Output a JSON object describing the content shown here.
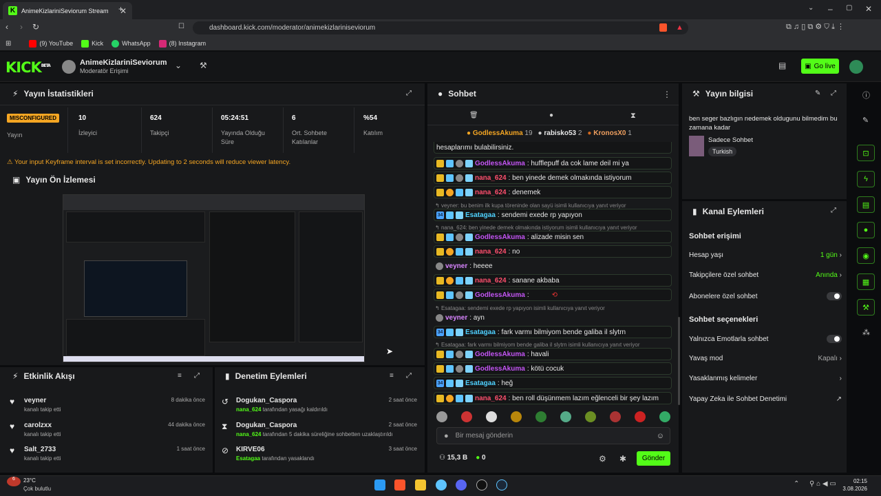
{
  "browser": {
    "tab_title": "AnimeKizlariniSeviorum Stream",
    "url": "dashboard.kick.com/moderator/animekizlariniseviorum",
    "bookmarks": [
      "(9) YouTube",
      "Kick",
      "WhatsApp",
      "(8) Instagram"
    ]
  },
  "header": {
    "logo": "KICK",
    "logo_beta": "BETA",
    "channel_name": "AnimeKizlariniSeviorum",
    "role": "Moderatör Erişimi",
    "go_live": "Go live"
  },
  "stats": {
    "title": "Yayın İstatistikleri",
    "status_badge": "MISCONFIGURED",
    "status_label": "Yayın",
    "items": [
      {
        "value": "10",
        "label": "İzleyici"
      },
      {
        "value": "624",
        "label": "Takipçi"
      },
      {
        "value": "05:24:51",
        "label": "Yayında Olduğu Süre"
      },
      {
        "value": "6",
        "label": "Ort. Sohbete Katılanlar"
      },
      {
        "value": "%54",
        "label": "Katılım"
      }
    ],
    "warning": "Your input Keyframe interval is set incorrectly. Updating to 2 seconds will reduce viewer latency."
  },
  "preview": {
    "title": "Yayın Ön İzlemesi"
  },
  "activity": {
    "title": "Etkinlik Akışı",
    "items": [
      {
        "name": "veyner",
        "sub": "kanalı takip etti",
        "time": "8 dakika önce"
      },
      {
        "name": "carolzxx",
        "sub": "kanalı takip etti",
        "time": "44 dakika önce"
      },
      {
        "name": "Salt_2733",
        "sub": "kanalı takip etti",
        "time": "1 saat önce"
      }
    ]
  },
  "moderation": {
    "title": "Denetim Eylemleri",
    "items": [
      {
        "name": "Dogukan_Caspora",
        "target": "nana_624",
        "rest": " tarafından yasağı kaldırıldı",
        "time": "2 saat önce"
      },
      {
        "name": "Dogukan_Caspora",
        "target": "nana_624",
        "rest": " tarafından 5 dakika süreliğine sohbetten uzaklaştırıldı",
        "time": "2 saat önce"
      },
      {
        "name": "KIRVE06",
        "target": "Esatagaa",
        "rest": " tarafından yasaklandı",
        "time": "3 saat önce"
      }
    ]
  },
  "chat": {
    "title": "Sohbet",
    "top": [
      {
        "name": "GodlessAkuma",
        "count": "19"
      },
      {
        "name": "rabisko53",
        "count": "2"
      },
      {
        "name": "KronosX0",
        "count": "1"
      }
    ],
    "first_line": "hesaplarımı bulabilirsiniz.",
    "messages": [
      {
        "user": "GodlessAkuma",
        "text": ": hufflepuff da cok lame deil mi ya",
        "color": "#c455f5"
      },
      {
        "user": "nana_624",
        "text": ": ben yinede demek olmakında istiyorum",
        "color": "#ff4f6d"
      },
      {
        "user": "nana_624",
        "text": ": denemek",
        "color": "#ff4f6d"
      },
      {
        "reply": "veyner: bu benim ilk kupa töreninde olan sayü isimli kullanıcıya yanıt veriyor"
      },
      {
        "user": "Esatagaa",
        "text": ": sendemi exede rp yapıyon",
        "color": "#4fd1ff"
      },
      {
        "reply": "nana_624: ben yinede demek olmakında istiyorum isimli kullanıcıya yanıt veriyor"
      },
      {
        "user": "GodlessAkuma",
        "text": ": alizade misin sen",
        "color": "#c455f5"
      },
      {
        "user": "nana_624",
        "text": ": no",
        "color": "#ff4f6d"
      },
      {
        "user": "veyner",
        "text": ": heeee",
        "color": "#d985ff"
      },
      {
        "user": "nana_624",
        "text": ": sanane akbaba",
        "color": "#ff4f6d"
      },
      {
        "user": "GodlessAkuma",
        "text": ":",
        "color": "#c455f5"
      },
      {
        "reply": "Esatagaa: sendemi exede rp yapıyon isimli kullanıcıya yanıt veriyor"
      },
      {
        "user": "veyner",
        "text": ": ayn",
        "color": "#d985ff"
      },
      {
        "user": "Esatagaa",
        "text": ": fark varmı bilmiyom bende galiba il slytrn",
        "color": "#4fd1ff"
      },
      {
        "reply": "Esatagaa: fark varmı bilmiyom bende galiba il slytrn isimli kullanıcıya yanıt veriyor"
      },
      {
        "user": "GodlessAkuma",
        "text": ": havali",
        "color": "#c455f5"
      },
      {
        "user": "GodlessAkuma",
        "text": ": kötü cocuk",
        "color": "#c455f5"
      },
      {
        "user": "Esatagaa",
        "text": ": heğ",
        "color": "#4fd1ff"
      },
      {
        "user": "nana_624",
        "text": ": ben roll düşünmem lazım eğlenceli bir şey lazım",
        "color": "#ff4f6d"
      }
    ],
    "input_placeholder": "Bir mesaj gönderin",
    "viewers": "15,3 B",
    "kicks": "0",
    "send": "Gönder"
  },
  "info": {
    "title": "Yayın bilgisi",
    "stream_title": "ben seger bazlıgın nedemek oldugunu bilmedim bu zamana kadar",
    "category": "Sadece Sohbet",
    "tag": "Turkish"
  },
  "actions": {
    "title": "Kanal Eylemleri",
    "access_title": "Sohbet erişimi",
    "access": [
      {
        "label": "Hesap yaşı",
        "value": "1 gün"
      },
      {
        "label": "Takipçilere özel sohbet",
        "value": "Anında"
      },
      {
        "label": "Abonelere özel sohbet",
        "value": ""
      }
    ],
    "options_title": "Sohbet seçenekleri",
    "options": [
      {
        "label": "Yalnızca Emotlarla sohbet",
        "value": ""
      },
      {
        "label": "Yavaş mod",
        "value": "Kapalı"
      },
      {
        "label": "Yasaklanmış kelimeler",
        "value": ""
      },
      {
        "label": "Yapay Zeka ile Sohbet Denetimi",
        "value": ""
      }
    ]
  },
  "taskbar": {
    "temp": "23°C",
    "weather": "Çok bulutlu",
    "time": "02:15",
    "date": "3.08.2026",
    "notif": "6"
  }
}
